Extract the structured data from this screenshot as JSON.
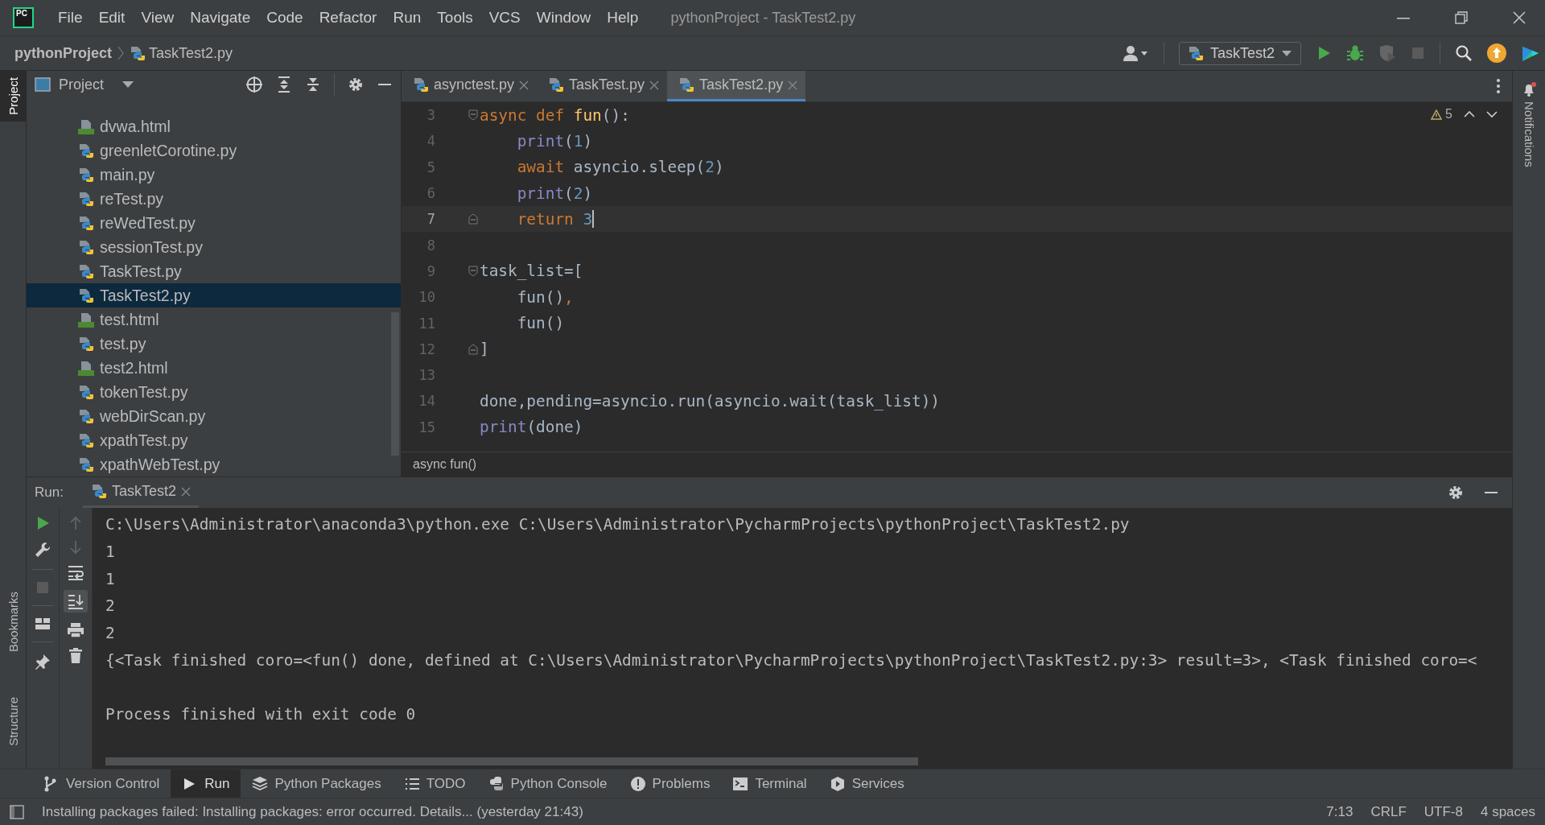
{
  "window": {
    "logo": "PC",
    "title": "pythonProject - TaskTest2.py"
  },
  "menu": [
    "File",
    "Edit",
    "View",
    "Navigate",
    "Code",
    "Refactor",
    "Run",
    "Tools",
    "VCS",
    "Window",
    "Help"
  ],
  "breadcrumb": [
    {
      "label": "pythonProject",
      "kind": "project"
    },
    {
      "label": "TaskTest2.py",
      "kind": "file"
    }
  ],
  "run_config": {
    "label": "TaskTest2"
  },
  "left_stripe": [
    {
      "label": "Project",
      "selected": true
    },
    {
      "label": "Bookmarks",
      "selected": false
    },
    {
      "label": "Structure",
      "selected": false
    }
  ],
  "right_stripe": [
    {
      "label": "Notifications",
      "selected": false
    }
  ],
  "project_panel": {
    "title": "Project",
    "files": [
      {
        "name": "dvwa.html",
        "kind": "html",
        "selected": false
      },
      {
        "name": "greenletCorotine.py",
        "kind": "python",
        "selected": false
      },
      {
        "name": "main.py",
        "kind": "python",
        "selected": false
      },
      {
        "name": "reTest.py",
        "kind": "python",
        "selected": false
      },
      {
        "name": "reWedTest.py",
        "kind": "python",
        "selected": false
      },
      {
        "name": "sessionTest.py",
        "kind": "python",
        "selected": false
      },
      {
        "name": "TaskTest.py",
        "kind": "python",
        "selected": false
      },
      {
        "name": "TaskTest2.py",
        "kind": "python",
        "selected": true
      },
      {
        "name": "test.html",
        "kind": "html",
        "selected": false
      },
      {
        "name": "test.py",
        "kind": "python",
        "selected": false
      },
      {
        "name": "test2.html",
        "kind": "html",
        "selected": false
      },
      {
        "name": "tokenTest.py",
        "kind": "python",
        "selected": false
      },
      {
        "name": "webDirScan.py",
        "kind": "python",
        "selected": false
      },
      {
        "name": "xpathTest.py",
        "kind": "python",
        "selected": false
      },
      {
        "name": "xpathWebTest.py",
        "kind": "python",
        "selected": false
      }
    ]
  },
  "editor": {
    "tabs": [
      {
        "label": "asynctest.py",
        "selected": false
      },
      {
        "label": "TaskTest.py",
        "selected": false
      },
      {
        "label": "TaskTest2.py",
        "selected": true
      }
    ],
    "warnings": "5",
    "lines": [
      {
        "number": "3",
        "current": false,
        "indented": false,
        "fold_start": true,
        "fold_end": false,
        "tokens": [
          {
            "kind": "keyword",
            "text": "async def "
          },
          {
            "kind": "function",
            "text": "fun"
          },
          {
            "kind": "plain",
            "text": "():"
          }
        ]
      },
      {
        "number": "4",
        "current": false,
        "indented": true,
        "fold_start": false,
        "fold_end": false,
        "tokens": [
          {
            "kind": "builtin",
            "text": "print"
          },
          {
            "kind": "plain",
            "text": "("
          },
          {
            "kind": "number",
            "text": "1"
          },
          {
            "kind": "plain",
            "text": ")"
          }
        ]
      },
      {
        "number": "5",
        "current": false,
        "indented": true,
        "fold_start": false,
        "fold_end": false,
        "tokens": [
          {
            "kind": "keyword",
            "text": "await "
          },
          {
            "kind": "plain",
            "text": "asyncio.sleep("
          },
          {
            "kind": "number",
            "text": "2"
          },
          {
            "kind": "plain",
            "text": ")"
          }
        ]
      },
      {
        "number": "6",
        "current": false,
        "indented": true,
        "fold_start": false,
        "fold_end": false,
        "tokens": [
          {
            "kind": "builtin",
            "text": "print"
          },
          {
            "kind": "plain",
            "text": "("
          },
          {
            "kind": "number",
            "text": "2"
          },
          {
            "kind": "plain",
            "text": ")"
          }
        ]
      },
      {
        "number": "7",
        "current": true,
        "indented": true,
        "fold_start": false,
        "fold_end": true,
        "tokens": [
          {
            "kind": "keyword",
            "text": "return "
          },
          {
            "kind": "number",
            "text": "3"
          }
        ]
      },
      {
        "number": "8",
        "current": false,
        "fold_start": false,
        "fold_end": false
      },
      {
        "number": "9",
        "current": false,
        "indented": false,
        "fold_start": true,
        "fold_end": false,
        "tokens": [
          {
            "kind": "plain",
            "text": "task_list=["
          }
        ]
      },
      {
        "number": "10",
        "current": false,
        "indented": true,
        "fold_start": false,
        "fold_end": false,
        "tokens": [
          {
            "kind": "plain",
            "text": "fun()"
          },
          {
            "kind": "keyword",
            "text": ","
          }
        ]
      },
      {
        "number": "11",
        "current": false,
        "indented": true,
        "fold_start": false,
        "fold_end": false,
        "tokens": [
          {
            "kind": "plain",
            "text": "fun()"
          }
        ]
      },
      {
        "number": "12",
        "current": false,
        "indented": false,
        "fold_start": false,
        "fold_end": true,
        "tokens": [
          {
            "kind": "plain",
            "text": "]"
          }
        ]
      },
      {
        "number": "13",
        "current": false,
        "fold_start": false,
        "fold_end": false
      },
      {
        "number": "14",
        "current": false,
        "indented": false,
        "fold_start": false,
        "fold_end": false,
        "tokens": [
          {
            "kind": "plain",
            "text": "done,pending=asyncio.run(asyncio.wait(task_list))"
          }
        ]
      },
      {
        "number": "15",
        "current": false,
        "indented": false,
        "fold_start": false,
        "fold_end": false,
        "tokens": [
          {
            "kind": "builtin",
            "text": "print"
          },
          {
            "kind": "plain",
            "text": "(done)"
          }
        ]
      }
    ],
    "breadcrumb": "async fun()"
  },
  "run_panel": {
    "label": "Run:",
    "tab": "TaskTest2",
    "output": [
      {
        "kind": "output",
        "text": "C:\\Users\\Administrator\\anaconda3\\python.exe C:\\Users\\Administrator\\PycharmProjects\\pythonProject\\TaskTest2.py"
      },
      {
        "kind": "output",
        "text": "1"
      },
      {
        "kind": "output",
        "text": "1"
      },
      {
        "kind": "output",
        "text": "2"
      },
      {
        "kind": "output",
        "text": "2"
      },
      {
        "kind": "output",
        "text": "{<Task finished coro=<fun() done, defined at C:\\Users\\Administrator\\PycharmProjects\\pythonProject\\TaskTest2.py:3> result=3>, <Task finished coro=<"
      },
      {
        "kind": "exit",
        "text": "Process finished with exit code 0"
      }
    ]
  },
  "tool_tabs": [
    {
      "label": "Version Control",
      "selected": false
    },
    {
      "label": "Run",
      "selected": true
    },
    {
      "label": "Python Packages",
      "selected": false
    },
    {
      "label": "TODO",
      "selected": false
    },
    {
      "label": "Python Console",
      "selected": false
    },
    {
      "label": "Problems",
      "selected": false
    },
    {
      "label": "Terminal",
      "selected": false
    },
    {
      "label": "Services",
      "selected": false
    }
  ],
  "status_bar": {
    "message": "Installing packages failed: Installing packages: error occurred. Details... (yesterday 21:43)",
    "items": [
      "7:13",
      "CRLF",
      "UTF-8",
      "4 spaces"
    ]
  }
}
